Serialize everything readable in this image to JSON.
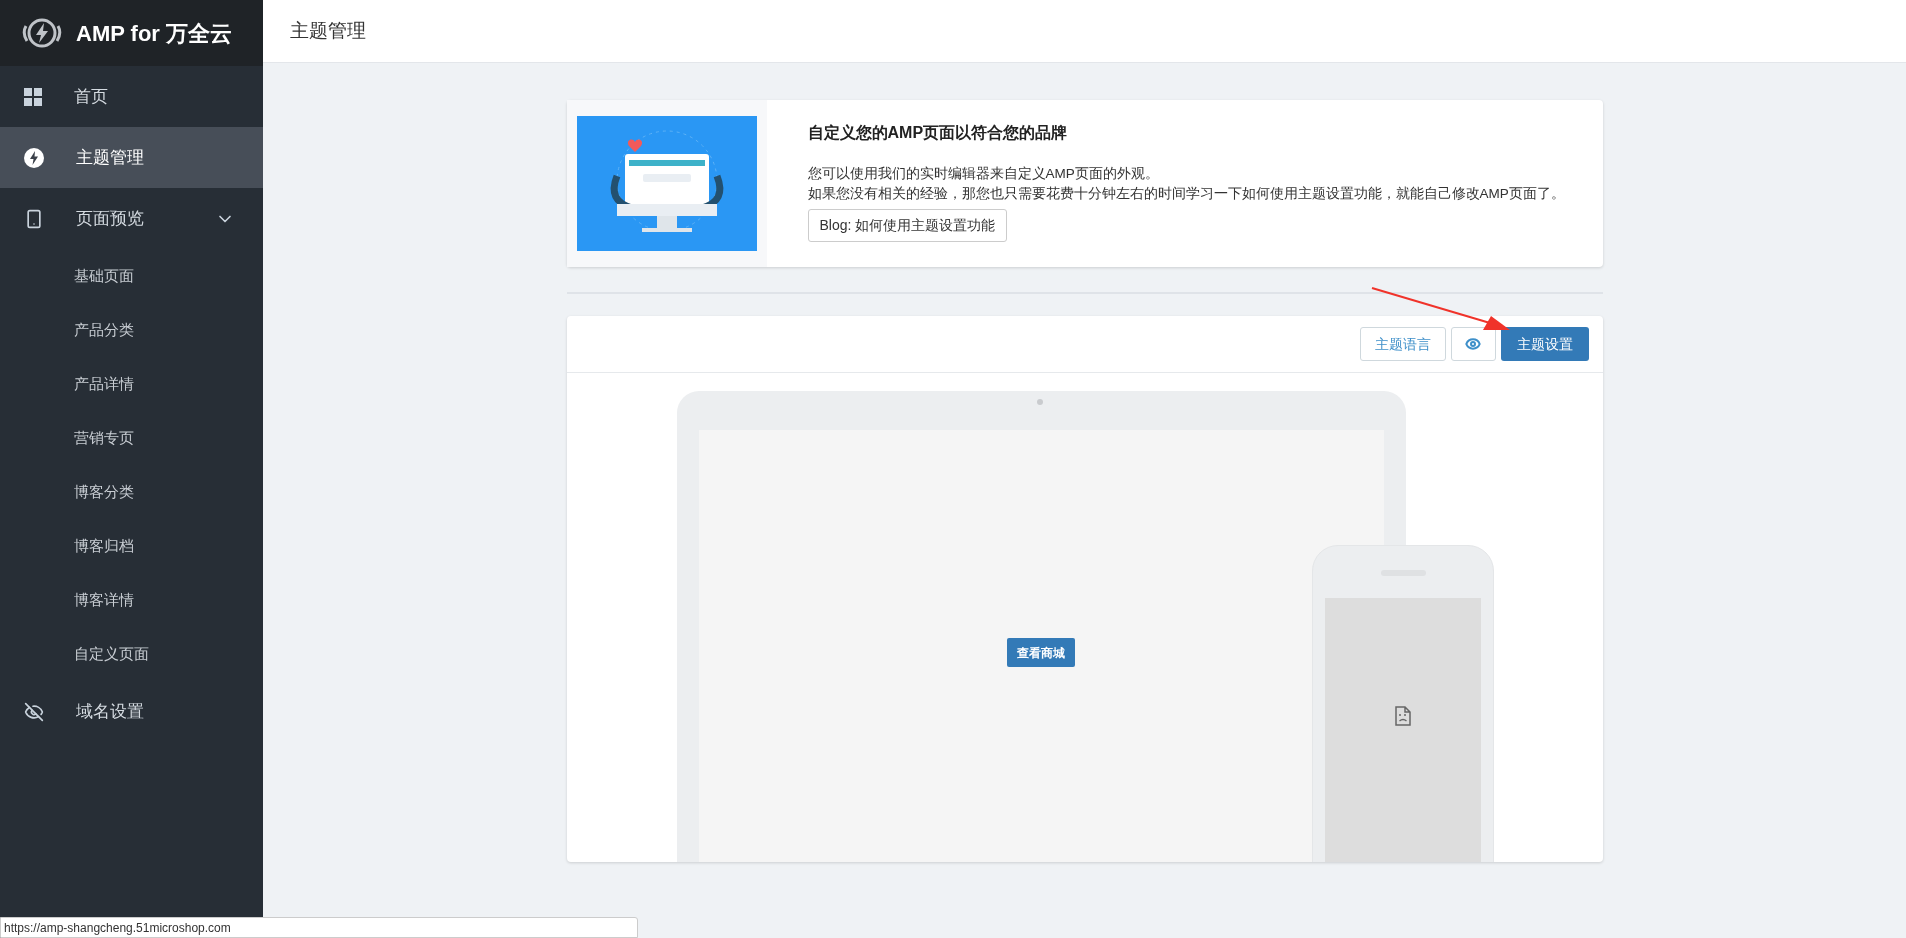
{
  "sidebar": {
    "logo": "AMP for 万全云",
    "items": [
      {
        "kind": "item",
        "label": "首页",
        "selected": false
      },
      {
        "kind": "item",
        "label": "主题管理",
        "selected": true
      },
      {
        "kind": "group",
        "label": "页面预览",
        "selected": false,
        "expanded": true,
        "children": [
          {
            "label": "基础页面",
            "selected": false
          },
          {
            "label": "产品分类",
            "selected": false
          },
          {
            "label": "产品详情",
            "selected": false
          },
          {
            "label": "营销专页",
            "selected": false
          },
          {
            "label": "博客分类",
            "selected": false
          },
          {
            "label": "博客归档",
            "selected": false
          },
          {
            "label": "博客详情",
            "selected": false
          },
          {
            "label": "自定义页面",
            "selected": false
          }
        ]
      },
      {
        "kind": "item",
        "label": "域名设置",
        "selected": false
      }
    ]
  },
  "header": {
    "title": "主题管理"
  },
  "intro_card": {
    "title": "自定义您的AMP页面以符合您的品牌",
    "lines": [
      "您可以使用我们的实时编辑器来自定义AMP页面的外观。",
      "如果您没有相关的经验，那您也只需要花费十分钟左右的时间学习一下如何使用主题设置功能，就能自己修改AMP页面了。"
    ],
    "button": "Blog: 如何使用主题设置功能"
  },
  "preview_card": {
    "toolbar": [
      {
        "kind": "outline",
        "label": "主题语言"
      },
      {
        "kind": "icon"
      },
      {
        "kind": "primary",
        "label": "主题设置"
      }
    ],
    "laptop_button": "查看商城"
  },
  "status_bar": {
    "url": "https://amp-shangcheng.51microshop.com"
  }
}
